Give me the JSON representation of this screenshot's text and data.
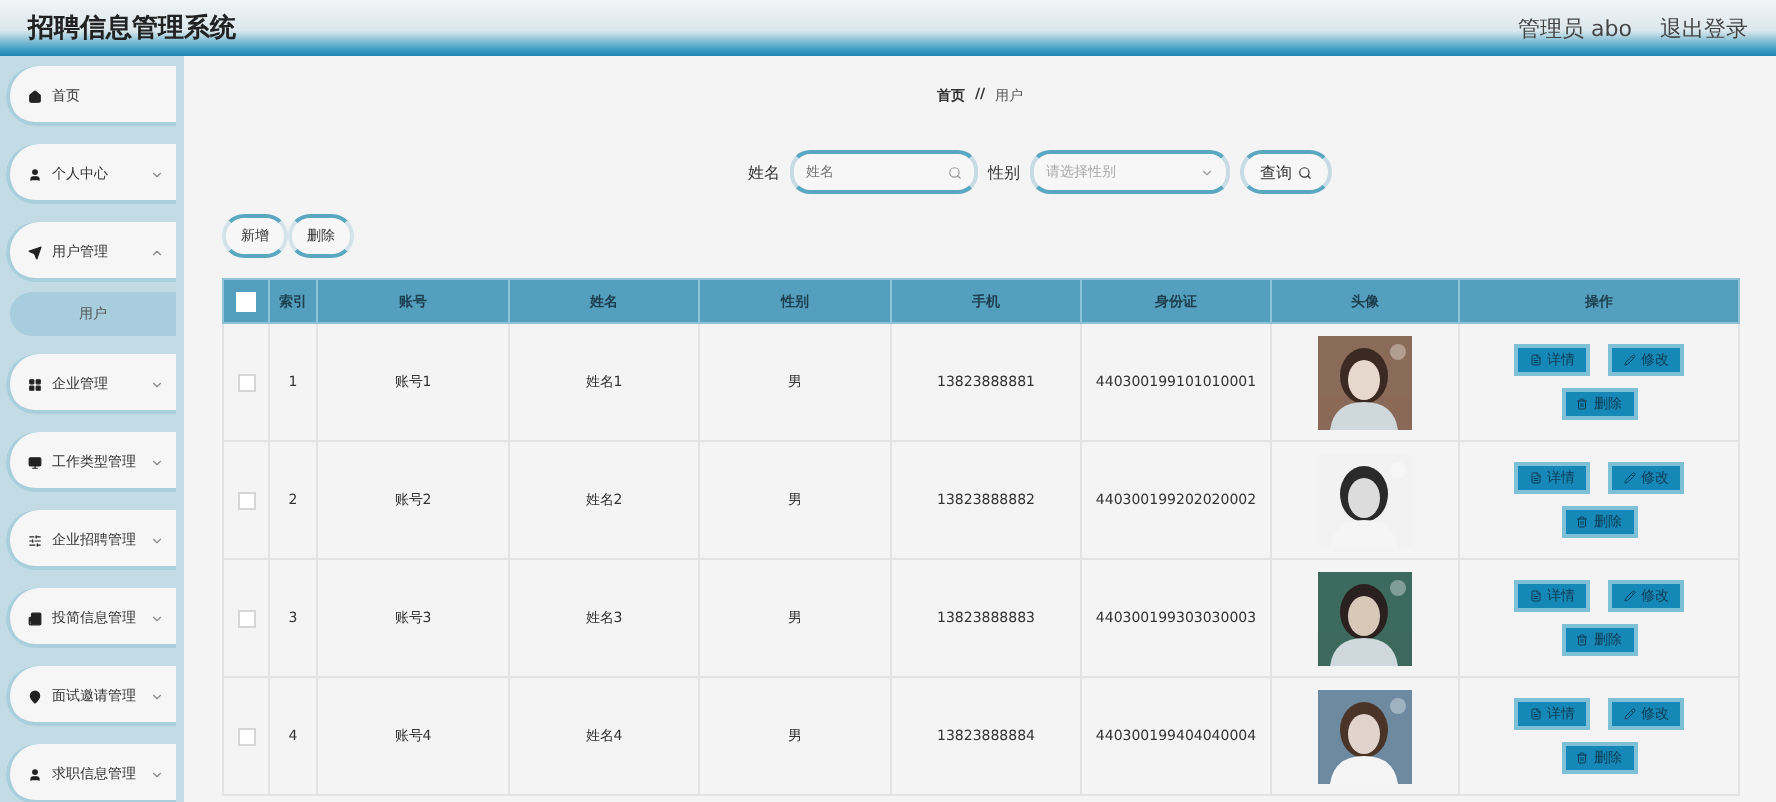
{
  "header": {
    "title": "招聘信息管理系统",
    "user": "管理员 abo",
    "logout": "退出登录"
  },
  "sidebar": {
    "items": [
      {
        "label": "首页",
        "expandable": false
      },
      {
        "label": "个人中心",
        "expandable": true,
        "expanded": false
      },
      {
        "label": "用户管理",
        "expandable": true,
        "expanded": true,
        "children": [
          {
            "label": "用户",
            "selected": true
          }
        ]
      },
      {
        "label": "企业管理",
        "expandable": true,
        "expanded": false
      },
      {
        "label": "工作类型管理",
        "expandable": true,
        "expanded": false
      },
      {
        "label": "企业招聘管理",
        "expandable": true,
        "expanded": false
      },
      {
        "label": "投简信息管理",
        "expandable": true,
        "expanded": false
      },
      {
        "label": "面试邀请管理",
        "expandable": true,
        "expanded": false
      },
      {
        "label": "求职信息管理",
        "expandable": true,
        "expanded": false
      }
    ]
  },
  "breadcrumb": {
    "items": [
      "首页",
      "用户"
    ],
    "separator": "//"
  },
  "search": {
    "name_field": {
      "label": "姓名",
      "placeholder": "姓名"
    },
    "gender_field": {
      "label": "性别",
      "placeholder": "请选择性别"
    },
    "button": "查询"
  },
  "actions": [
    "新增",
    "删除"
  ],
  "table": {
    "select_all": {
      "checked": false
    },
    "columns": [
      "索引",
      "账号",
      "姓名",
      "性别",
      "手机",
      "身份证",
      "头像",
      "操作"
    ],
    "rows": [
      {
        "checked": false,
        "cells": [
          "1",
          "账号1",
          "姓名1",
          "男",
          "13823888881",
          "440300199101010001"
        ],
        "avatar": {
          "kind": "picture"
        },
        "buttons": [
          "详情",
          "修改",
          "删除"
        ]
      },
      {
        "checked": false,
        "cells": [
          "2",
          "账号2",
          "姓名2",
          "男",
          "13823888882",
          "440300199202020002"
        ],
        "avatar": {
          "kind": "picture"
        },
        "buttons": [
          "详情",
          "修改",
          "删除"
        ]
      },
      {
        "checked": false,
        "cells": [
          "3",
          "账号3",
          "姓名3",
          "男",
          "13823888883",
          "440300199303030003"
        ],
        "avatar": {
          "kind": "picture"
        },
        "buttons": [
          "详情",
          "修改",
          "删除"
        ]
      },
      {
        "checked": false,
        "cells": [
          "4",
          "账号4",
          "姓名4",
          "男",
          "13823888884",
          "440300199404040004"
        ],
        "avatar": {
          "kind": "picture"
        },
        "buttons": [
          "详情",
          "修改",
          "删除"
        ]
      }
    ]
  }
}
